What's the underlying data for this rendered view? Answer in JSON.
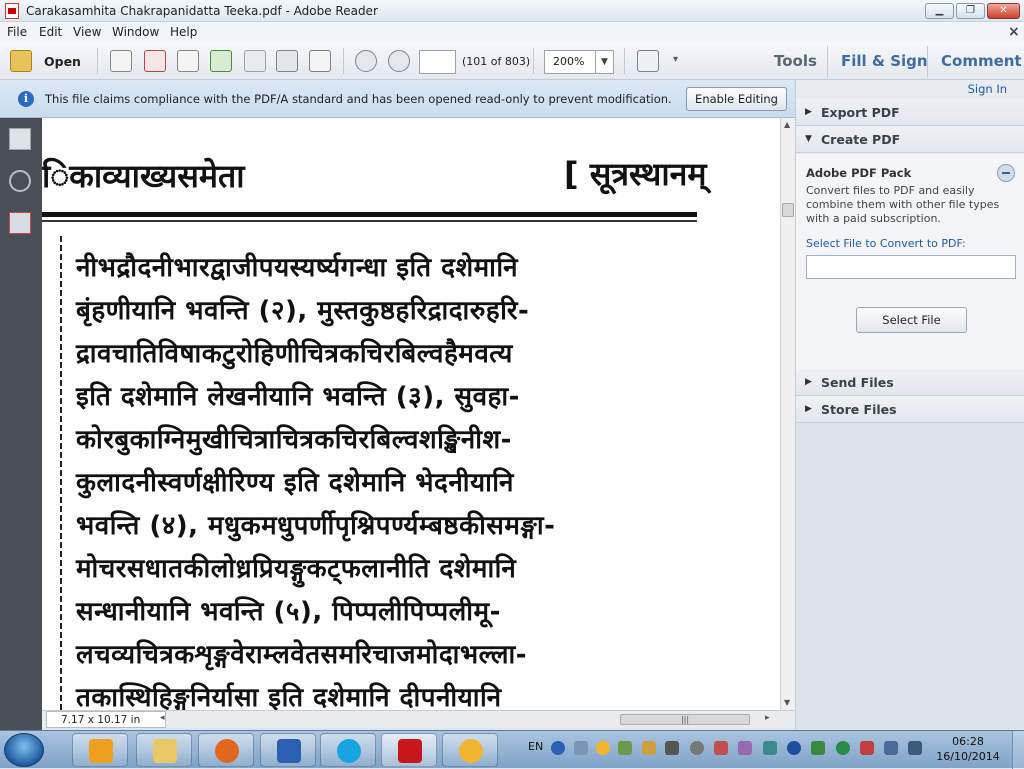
{
  "window": {
    "title": "Carakasamhita Chakrapanidatta Teeka.pdf - Adobe Reader",
    "minimize_label": "▁",
    "maximize_label": "❐",
    "close_label": "✕"
  },
  "menubar": {
    "items": [
      "File",
      "Edit",
      "View",
      "Window",
      "Help"
    ],
    "close_glyph": "×"
  },
  "toolbar": {
    "open_label": "Open",
    "page_input_value": "",
    "page_count": "(101 of 803)",
    "zoom_value": "200%",
    "zoom_dropdown_glyph": "▼",
    "more_glyph": "▾",
    "tabs": [
      "Tools",
      "Fill & Sign",
      "Comment"
    ]
  },
  "infobar": {
    "icon_glyph": "i",
    "message": "This file claims compliance with the PDF/A standard and has been opened read-only to prevent modification.",
    "button_label": "Enable Editing"
  },
  "document": {
    "header_left": "िकाव्याख्यसमेता",
    "header_right": "[ सूत्रस्थानम्",
    "lines": [
      "नीभद्रौदनीभारद्वाजीपयस्यर्ष्यगन्धा इति दशेमानि",
      "बृंहणीयानि भवन्ति (२), मुस्तकुष्ठहरिद्रादारुहरि-",
      "द्रावचातिविषाकटुरोहिणीचित्रकचिरबिल्वहैमवत्य",
      "इति दशेमानि लेखनीयानि भवन्ति (३), सुवहा-",
      "कोरबुकाग्निमुखीचित्राचित्रकचिरबिल्वशङ्खिनीश-",
      "कुलादनीस्वर्णक्षीरिण्य इति दशेमानि भेदनीयानि",
      "भवन्ति (४), मधुकमधुपर्णीपृश्निपर्ण्यम्बष्ठकीसमङ्गा-",
      "मोचरसधातकीलोध्रप्रियङ्गुकट्फलानीति दशेमानि",
      "सन्धानीयानि भवन्ति (५), पिप्पलीपिप्पलीमू-",
      "लचव्यचित्रकशृङ्गवेराम्लवेतसमरिचाजमोदाभल्ला-",
      "तकास्थिहिङ्गुनिर्यासा इति दशेमानि दीपनीयानि"
    ]
  },
  "statusbar": {
    "page_size": "7.17 x 10.17 in",
    "scroll_grip": "|||",
    "left_arrow": "◂",
    "right_arrow": "▸"
  },
  "right_panel": {
    "sign_in": "Sign In",
    "sections": [
      {
        "label": "Export PDF",
        "expanded": false
      },
      {
        "label": "Create PDF",
        "expanded": true
      },
      {
        "label": "Send Files",
        "expanded": false
      },
      {
        "label": "Store Files",
        "expanded": false
      }
    ],
    "collapsed_glyph": "▶",
    "expanded_glyph": "▼",
    "pdf_pack_title": "Adobe PDF Pack",
    "pdf_pack_desc": "Convert files to PDF and easily combine them with other file types with a paid subscription.",
    "select_label": "Select File to Convert to PDF:",
    "select_input_value": "",
    "select_button": "Select File"
  },
  "taskbar": {
    "language": "EN",
    "time": "06:28",
    "date": "16/10/2014",
    "apps": [
      "media-player",
      "file-explorer",
      "firefox",
      "word",
      "skype",
      "adobe-reader",
      "flower-app"
    ]
  },
  "colors": {
    "accent_blue": "#3f6da3",
    "info_bar": "#c9dcef",
    "left_nav": "#4a4f57"
  }
}
